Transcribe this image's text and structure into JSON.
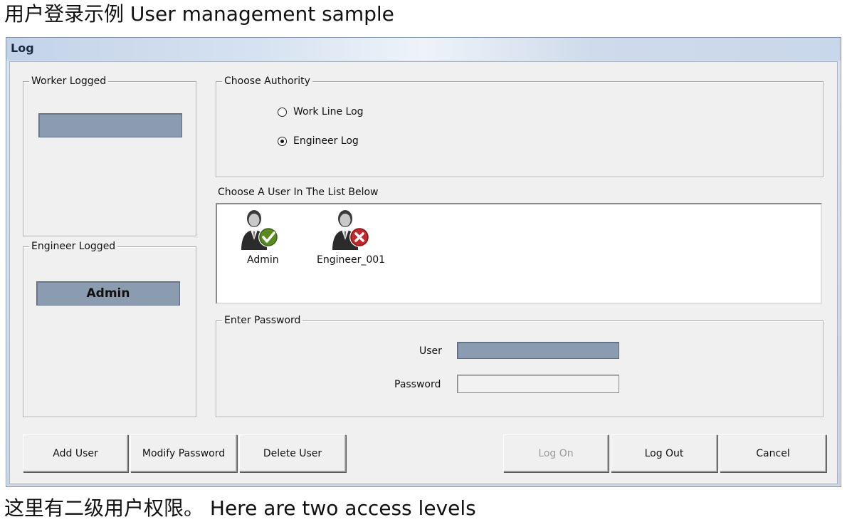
{
  "captions": {
    "top": "用户登录示例  User management sample",
    "bottom": "这里有二级用户权限。  Here are two access levels"
  },
  "window": {
    "title": "Log"
  },
  "worker_logged": {
    "label": "Worker Logged",
    "value": ""
  },
  "engineer_logged": {
    "label": "Engineer Logged",
    "value": "Admin"
  },
  "authority": {
    "label": "Choose Authority",
    "options": [
      {
        "label": "Work Line Log",
        "checked": false
      },
      {
        "label": "Engineer Log",
        "checked": true
      }
    ]
  },
  "user_list": {
    "label": "Choose A User In The List Below",
    "users": [
      {
        "name": "Admin",
        "status": "active",
        "badge_color": "#5a8a1e",
        "icon": "user-check-icon"
      },
      {
        "name": "Engineer_001",
        "status": "inactive",
        "badge_color": "#c0282c",
        "icon": "user-x-icon"
      }
    ]
  },
  "password": {
    "label": "Enter Password",
    "user_label": "User",
    "user_value": "",
    "password_label": "Password",
    "password_value": ""
  },
  "buttons": {
    "add_user": "Add User",
    "modify_password": "Modify Password",
    "delete_user": "Delete User",
    "log_on": "Log On",
    "log_out": "Log Out",
    "cancel": "Cancel"
  }
}
